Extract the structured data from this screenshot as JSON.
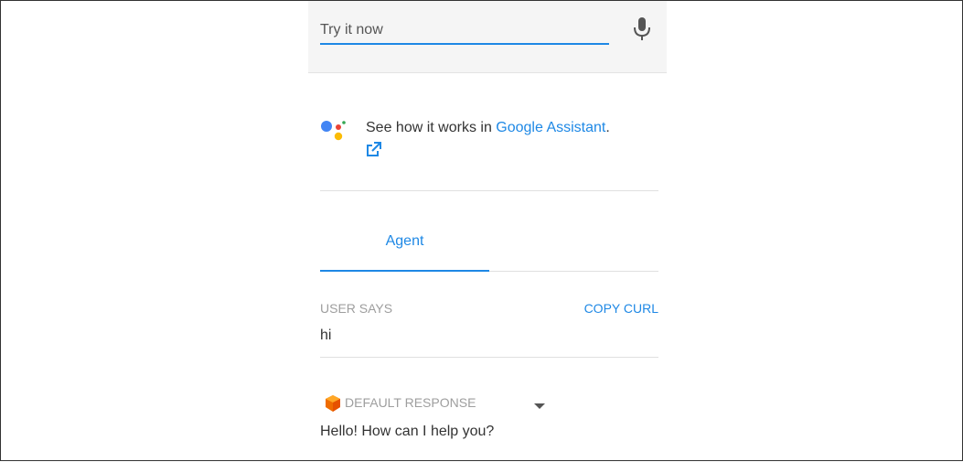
{
  "try_it": {
    "placeholder": "Try it now",
    "mic_icon": "microphone-icon"
  },
  "assistant": {
    "text": "See how it works in ",
    "link_text": "Google Assistant",
    "suffix": ".",
    "logo_icon": "google-assistant-logo",
    "external_icon": "external-link-icon"
  },
  "tabs": [
    {
      "label": "Agent",
      "active": true
    }
  ],
  "user_says": {
    "label": "USER SAYS",
    "copy_label": "COPY CURL",
    "value": "hi"
  },
  "response": {
    "label": "DEFAULT RESPONSE",
    "icon": "response-cube-icon",
    "value": "Hello! How can I help you?"
  },
  "colors": {
    "accent": "#1e88e5",
    "muted": "#9e9e9e",
    "text": "#333333",
    "bar_bg": "#f5f5f5",
    "response_icon": "#ef6c00"
  }
}
